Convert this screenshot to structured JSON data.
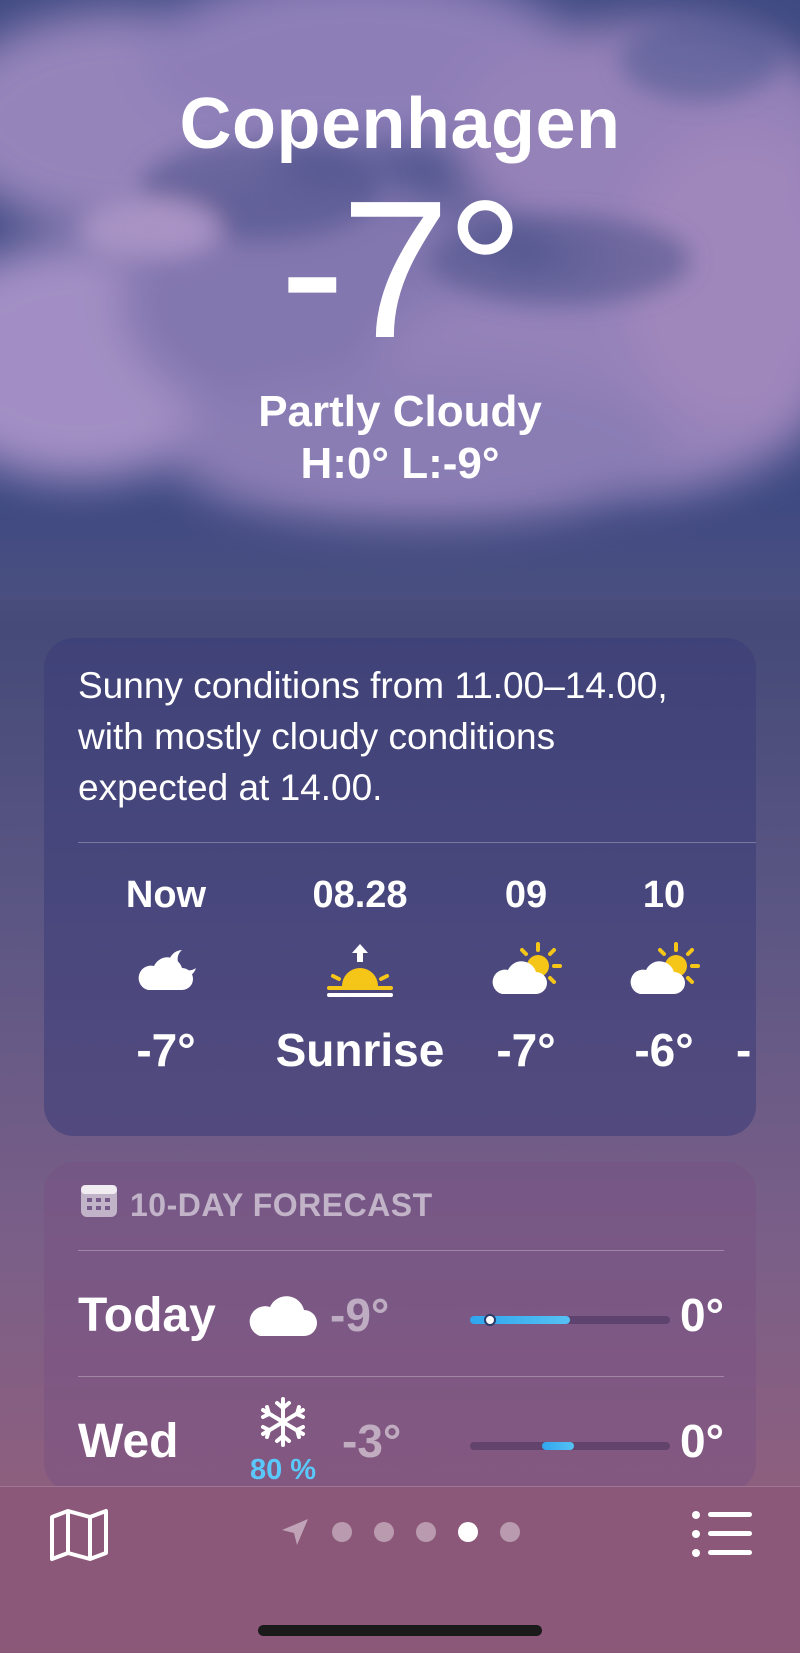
{
  "location": {
    "city": "Copenhagen",
    "temperature": "-7°",
    "condition": "Partly Cloudy",
    "high_low": "H:0°  L:-9°"
  },
  "hourly": {
    "summary": "Sunny conditions from 11.00–14.00, with mostly cloudy conditions expected at 14.00.",
    "items": [
      {
        "time": "Now",
        "icon": "cloud-moon-icon",
        "temp": "-7°"
      },
      {
        "time": "08.28",
        "icon": "sunrise-icon",
        "temp": "Sunrise"
      },
      {
        "time": "09",
        "icon": "cloud-sun-icon",
        "temp": "-7°"
      },
      {
        "time": "10",
        "icon": "cloud-sun-icon",
        "temp": "-6°"
      },
      {
        "time": "",
        "icon": "sun-icon",
        "temp": "-"
      }
    ]
  },
  "forecast": {
    "title": "10-DAY FORECAST",
    "icon": "calendar-icon",
    "days": [
      {
        "day": "Today",
        "icon": "cloud-icon",
        "low": "-9°",
        "high": "0°",
        "precip": "",
        "range_start": 0.0,
        "range_end": 0.5,
        "current_marker": 0.1
      },
      {
        "day": "Wed",
        "icon": "snowflake-icon",
        "low": "-3°",
        "high": "0°",
        "precip": "80 %",
        "range_start": 0.36,
        "range_end": 0.52
      }
    ]
  },
  "toolbar": {
    "map_icon": "map-icon",
    "list_icon": "list-icon",
    "pages": 5,
    "active_page": 3
  },
  "colors": {
    "accent_blue": "#5ac8fa",
    "sun_yellow": "#f5c518"
  }
}
